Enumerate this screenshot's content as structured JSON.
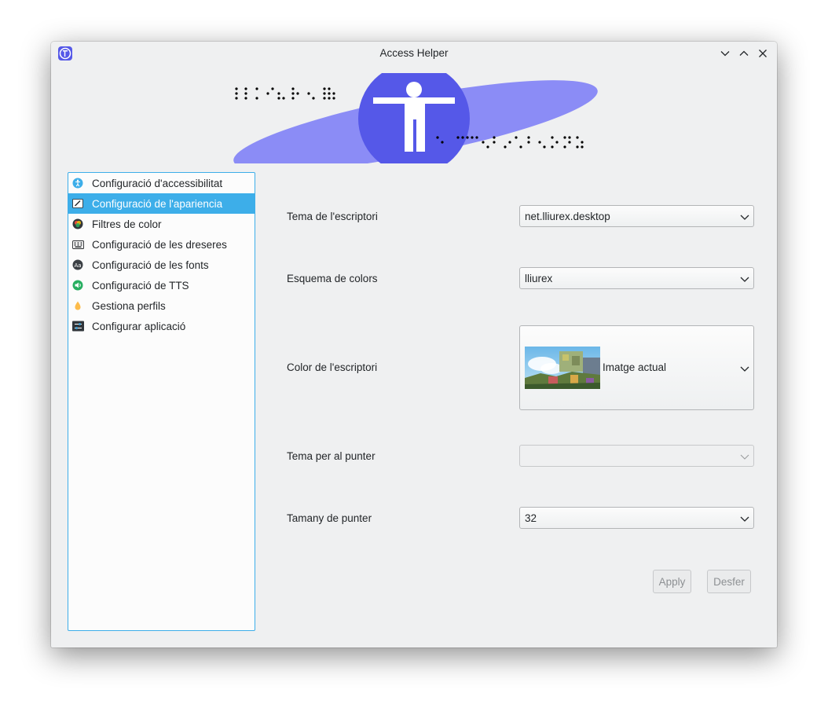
{
  "window": {
    "title": "Access Helper"
  },
  "sidebar": {
    "items": [
      {
        "label": "Configuració d'accessibilitat",
        "icon": "accessibility-icon",
        "selected": false
      },
      {
        "label": "Configuració de l'apariencia",
        "icon": "appearance-icon",
        "selected": true
      },
      {
        "label": "Filtres de color",
        "icon": "color-filter-icon",
        "selected": false
      },
      {
        "label": "Configuració de les dreseres",
        "icon": "keyboard-icon",
        "selected": false
      },
      {
        "label": "Configuració de les fonts",
        "icon": "fonts-icon",
        "selected": false
      },
      {
        "label": "Configuració de TTS",
        "icon": "tts-icon",
        "selected": false
      },
      {
        "label": "Gestiona perfils",
        "icon": "profiles-icon",
        "selected": false
      },
      {
        "label": "Configurar aplicació",
        "icon": "app-settings-icon",
        "selected": false
      }
    ]
  },
  "form": {
    "desktop_theme": {
      "label": "Tema de l'escriptori",
      "value": "net.lliurex.desktop"
    },
    "color_scheme": {
      "label": "Esquema de colors",
      "value": "lliurex"
    },
    "desktop_color": {
      "label": "Color de l'escriptori",
      "value": "Imatge actual"
    },
    "pointer_theme": {
      "label": "Tema per al punter",
      "value": ""
    },
    "pointer_size": {
      "label": "Tamany de punter",
      "value": "32"
    }
  },
  "actions": {
    "apply": "Apply",
    "undo": "Desfer"
  },
  "colors": {
    "accent": "#3daee9",
    "banner_ellipse": "#8b8cf6",
    "banner_circle": "#5558e8"
  }
}
